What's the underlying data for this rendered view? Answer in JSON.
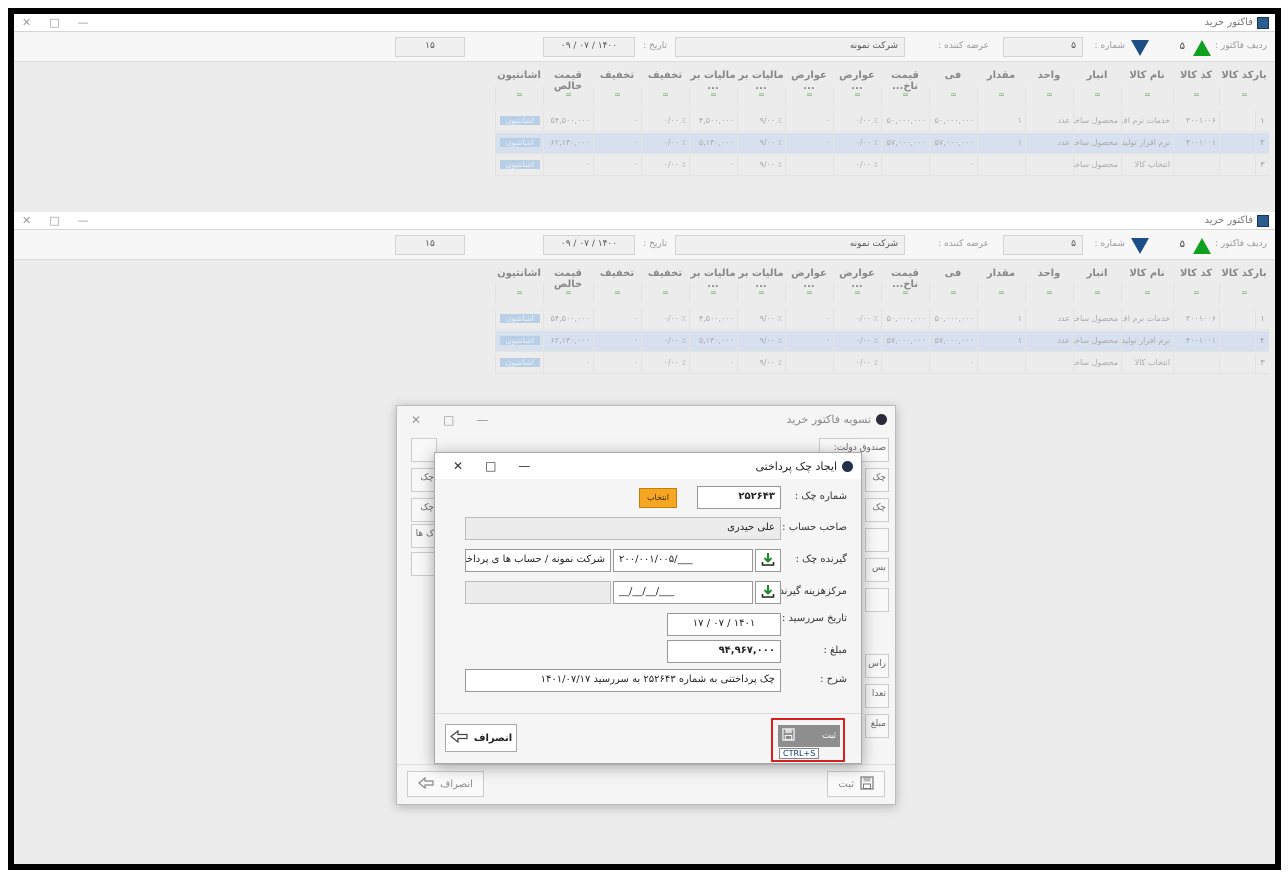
{
  "window": {
    "title": "فاکتور خرید",
    "min": "—",
    "max": "□",
    "close": "✕"
  },
  "header": {
    "row_label": "ردیف فاکتور :",
    "row_value": "۵",
    "number_label": "شماره :",
    "number_value": "۵",
    "supplier_label": "عرضه کننده :",
    "supplier_value": "شرکت نمونه",
    "date_label": "تاریخ :",
    "date_value": "۱۴۰۰ / ۰۷ / ۰۹",
    "count_value": "۱۵"
  },
  "grid": {
    "columns": [
      "بارکد کالا",
      "کد کالا",
      "نام کالا",
      "انبار",
      "واحد",
      "مقدار",
      "فی",
      "قیمت ناخ...",
      "عوارض ...",
      "عوارض ...",
      "مالیات بر ...",
      "مالیات بر ...",
      "تخفیف",
      "تخفیف",
      "قیمت خالص",
      "اشانتیون"
    ],
    "filter_mark": "=",
    "rows": [
      {
        "num": "۱",
        "barcode": "",
        "code": "۳۰۰۱۰۰۶",
        "name": "خدمات نرم اف",
        "warehouse": "محصول ساخت",
        "unit": "عدد",
        "qty": "۱",
        "price": "۵۰,۰۰۰,۰۰۰",
        "gross": "۵۰,۰۰۰,۰۰۰",
        "duty1": "٪ ۰/۰۰",
        "duty2": "۰",
        "tax1": "٪ ۹/۰۰",
        "tax2": "۴,۵۰۰,۰۰۰",
        "disc1": "٪ ۰/۰۰",
        "disc2": "۰",
        "net": "۵۴,۵۰۰,۰۰۰",
        "gift": "اشانتیون"
      },
      {
        "num": "۲",
        "barcode": "",
        "code": "۴۰۰۱۰۰۱",
        "name": "نرم افزار تولید",
        "warehouse": "محصول ساخت",
        "unit": "عدد",
        "qty": "۱",
        "price": "۵۷,۰۰۰,۰۰۰",
        "gross": "۵۷,۰۰۰,۰۰۰",
        "duty1": "٪ ۰/۰۰",
        "duty2": "۰",
        "tax1": "٪ ۹/۰۰",
        "tax2": "۵,۱۳۰,۰۰۰",
        "disc1": "٪ ۰/۰۰",
        "disc2": "۰",
        "net": "۶۲,۱۳۰,۰۰۰",
        "gift": "اشانتیون"
      },
      {
        "num": "۳",
        "barcode": "",
        "code": "",
        "name": "انتخاب کالا",
        "warehouse": "محصول ساخت",
        "unit": "",
        "qty": "",
        "price": "۰",
        "gross": "",
        "duty1": "٪ ۰/۰۰",
        "duty2": "",
        "tax1": "٪ ۹/۰۰",
        "tax2": "۰",
        "disc1": "٪ ۰/۰۰",
        "disc2": "۰",
        "net": "۰",
        "gift": "اشانتیون"
      }
    ]
  },
  "settle_dialog": {
    "title": "تسویه فاکتور خرید",
    "side_right": [
      "صندوق دولت:",
      "چک",
      "چک",
      "",
      "بس",
      "",
      "راس",
      "تعدا",
      "مبلغ"
    ],
    "side_left": [
      "",
      "چک",
      "چک",
      "ک ها",
      ""
    ],
    "save_label": "ثبت",
    "cancel_label": "انصراف"
  },
  "check_dialog": {
    "title": "ایجاد چک پرداختی",
    "check_no_label": "شماره چک :",
    "check_no": "۲۵۲۶۴۳",
    "select_btn": "انتخاب",
    "owner_label": "صاحب حساب :",
    "owner": "علی حیدری",
    "receiver_label": "گیرنده چک :",
    "receiver_code": "۲۰۰/۰۰۱/۰۰۵/___",
    "receiver_name": "شرکت نمونه / حساب ها ی پرداختنی تجاری",
    "cost_center_label": "مرکزهزینه گیرنده :",
    "cost_center_code": "__/__/__/___",
    "due_label": "تاریخ سررسید :",
    "due_date": "۱۴۰۱ / ۰۷ / ۱۷",
    "amount_label": "مبلغ :",
    "amount": "۹۴,۹۶۷,۰۰۰",
    "desc_label": "شرح :",
    "desc": "چک پرداختنی به شماره ۲۵۲۶۴۳ به سررسید ۱۴۰۱/۰۷/۱۷",
    "save_label": "ثبت",
    "shortcut": "CTRL+S",
    "cancel_label": "انصراف"
  }
}
